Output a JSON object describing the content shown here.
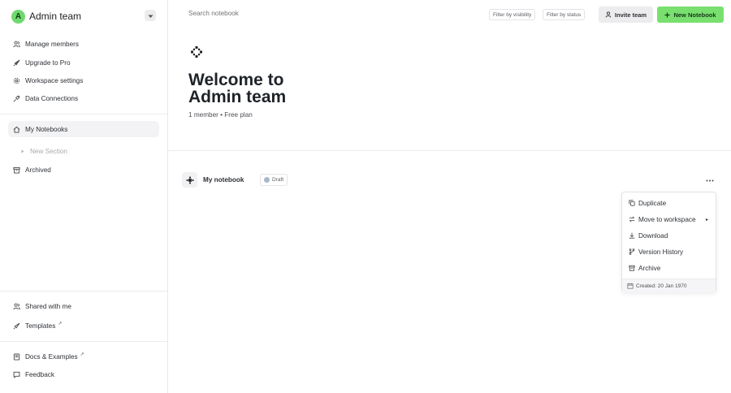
{
  "workspace": {
    "avatar_letter": "A",
    "name": "Admin team",
    "accent": "#6fd86f"
  },
  "sidebar": {
    "top_items": [
      {
        "label": "Manage members",
        "icon": "users-icon"
      },
      {
        "label": "Upgrade to Pro",
        "icon": "rocket-icon"
      },
      {
        "label": "Workspace settings",
        "icon": "gear-icon"
      },
      {
        "label": "Data Connections",
        "icon": "plug-icon"
      }
    ],
    "notebooks": {
      "label": "My Notebooks",
      "icon": "home-icon"
    },
    "new_section": {
      "label": "New Section",
      "icon": "chevron-right-icon"
    },
    "archived": {
      "label": "Archived",
      "icon": "archive-icon"
    },
    "bottom_items": [
      {
        "label": "Shared with me",
        "icon": "users-icon"
      },
      {
        "label": "Templates",
        "icon": "rocket-icon",
        "external": "↗"
      },
      {
        "label": "Docs & Examples",
        "icon": "book-icon",
        "external": "↗"
      },
      {
        "label": "Feedback",
        "icon": "chat-icon"
      }
    ]
  },
  "topbar": {
    "search_placeholder": "Search notebook",
    "filter_visibility": "Filter by visibility",
    "filter_status": "Filter by status",
    "invite_label": "Invite team",
    "new_notebook_label": "New Notebook",
    "new_notebook_color": "#79e06f"
  },
  "hero": {
    "title_line1": "Welcome to",
    "title_line2": "Admin team",
    "subtitle": "1 member • Free plan"
  },
  "notebook": {
    "title": "My notebook",
    "status": "Draft"
  },
  "menu": {
    "items": [
      {
        "label": "Duplicate",
        "icon": "copy-icon"
      },
      {
        "label": "Move to workspace",
        "icon": "move-icon",
        "submenu": "▸"
      },
      {
        "label": "Download",
        "icon": "download-icon"
      },
      {
        "label": "Version History",
        "icon": "branch-icon"
      },
      {
        "label": "Archive",
        "icon": "archive-icon"
      }
    ],
    "created": "Created: 20 Jan 1970"
  }
}
